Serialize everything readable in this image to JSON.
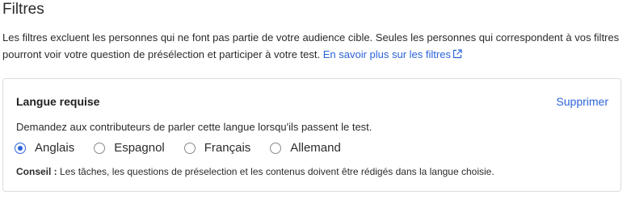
{
  "section": {
    "title": "Filtres",
    "description": "Les filtres excluent les personnes qui ne font pas partie de votre audience cible. Seules les personnes qui correspondent à vos filtres pourront voir votre question de présélection et participer à votre test.",
    "learn_more_link": "En savoir plus sur les filtres",
    "link_color": "#2b63d9"
  },
  "filter_card": {
    "title": "Langue requise",
    "delete_label": "Supprimer",
    "description": "Demandez aux contributeurs de parler cette langue lorsqu'ils passent le test.",
    "languages": [
      {
        "label": "Anglais",
        "selected": true
      },
      {
        "label": "Espagnol",
        "selected": false
      },
      {
        "label": "Français",
        "selected": false
      },
      {
        "label": "Allemand",
        "selected": false
      }
    ],
    "tip_label": "Conseil :",
    "tip_text": " Les tâches, les questions de préselection et les contenus doivent être rédigés dans la langue choisie."
  }
}
